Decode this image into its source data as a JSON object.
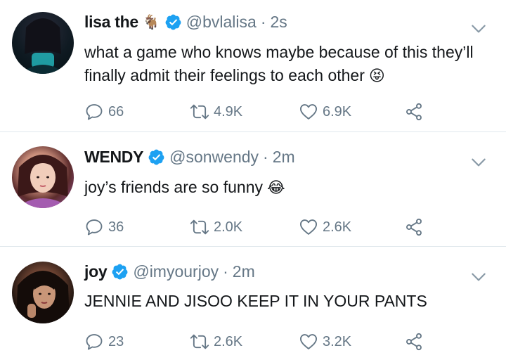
{
  "tweets": [
    {
      "name": "lisa the",
      "name_emoji": "🐐",
      "handle": "@bvlalisa",
      "separator": "·",
      "time": "2s",
      "text": "what a game who knows maybe because of this they’ll finally admit their feelings to each other",
      "text_emoji": "😝",
      "replies": "66",
      "retweets": "4.9K",
      "likes": "6.9K"
    },
    {
      "name": "WENDY",
      "handle": "@sonwendy",
      "separator": "·",
      "time": "2m",
      "text": "joy’s friends are so funny",
      "text_emoji": "😂",
      "replies": "36",
      "retweets": "2.0K",
      "likes": "2.6K"
    },
    {
      "name": "joy",
      "handle": "@imyourjoy",
      "separator": "·",
      "time": "2m",
      "text": "JENNIE AND JISOO KEEP IT IN YOUR PANTS",
      "replies": "23",
      "retweets": "2.6K",
      "likes": "3.2K"
    }
  ],
  "colors": {
    "text": "#14171a",
    "muted": "#657786",
    "verified": "#1da1f2",
    "divider": "#e1e8ed"
  },
  "icons": [
    "reply-icon",
    "retweet-icon",
    "like-icon",
    "share-icon",
    "chevron-down-icon",
    "verified-badge-icon"
  ]
}
